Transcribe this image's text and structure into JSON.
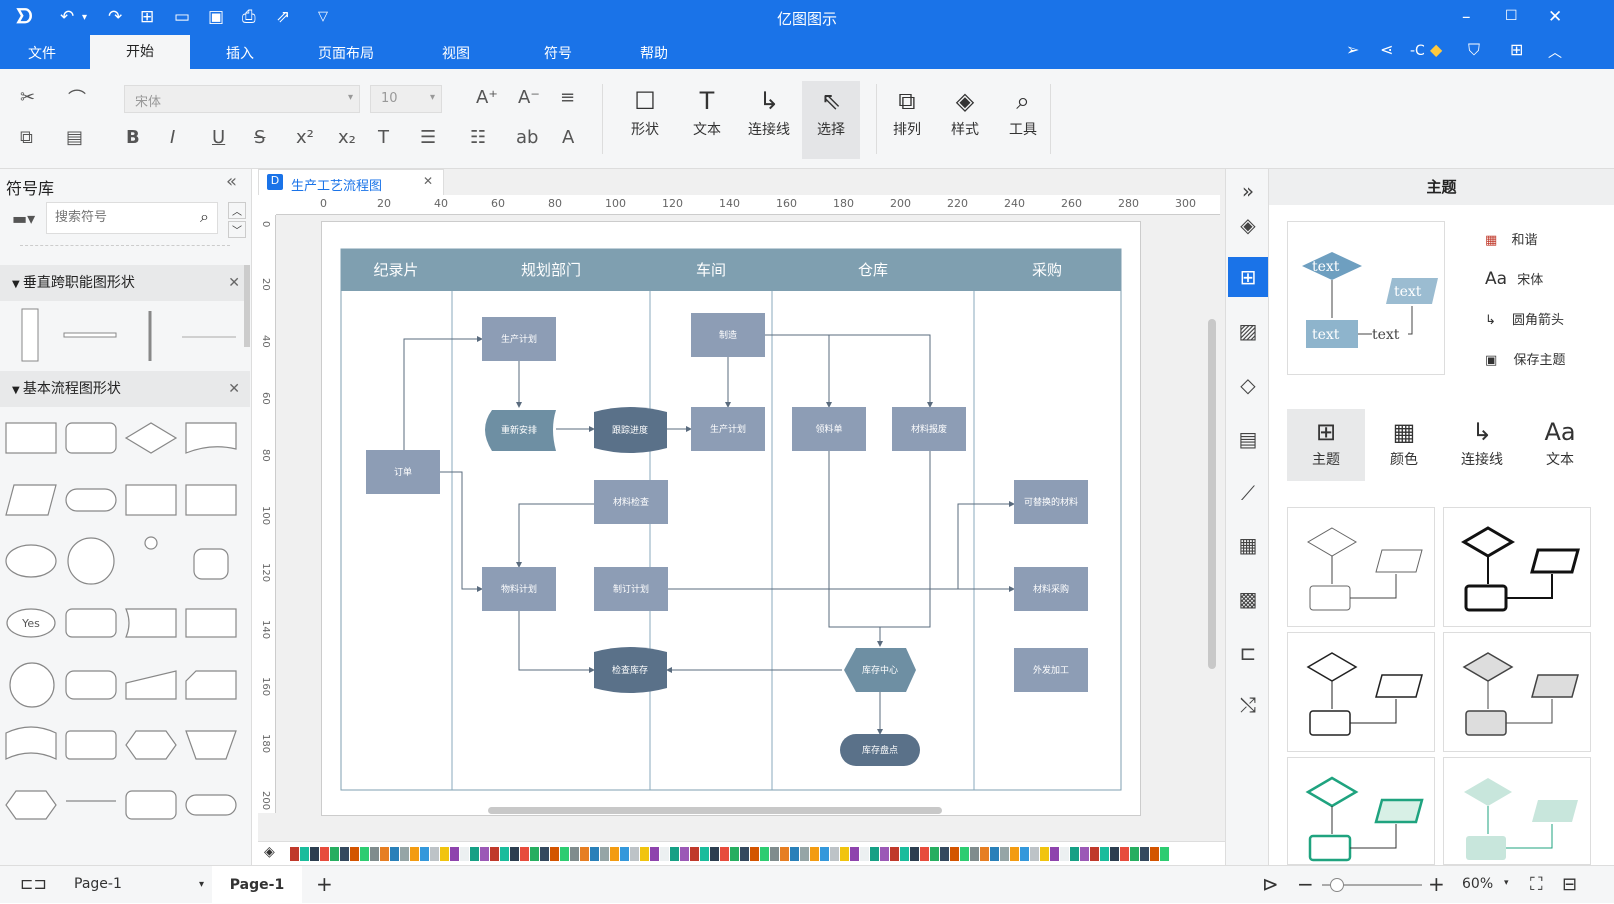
{
  "app": {
    "title": "亿图图示"
  },
  "menu": [
    "文件",
    "开始",
    "插入",
    "页面布局",
    "视图",
    "符号",
    "帮助"
  ],
  "user": {
    "label": "-C"
  },
  "toolbar": {
    "font_family": "宋体",
    "font_size": "10",
    "shape_label": "形状",
    "text_label": "文本",
    "connector_label": "连接线",
    "select_label": "选择",
    "arrange_label": "排列",
    "style_label": "样式",
    "tools_label": "工具"
  },
  "left_panel": {
    "title": "符号库",
    "search_placeholder": "搜索符号",
    "category1": "垂直跨职能图形状",
    "category2": "基本流程图形状",
    "yes_label": "Yes"
  },
  "document": {
    "tab_title": "生产工艺流程图",
    "ruler_h": [
      "0",
      "20",
      "40",
      "60",
      "80",
      "100",
      "120",
      "140",
      "160",
      "180",
      "200",
      "220",
      "240",
      "260",
      "280",
      "300"
    ],
    "ruler_v": [
      "0",
      "20",
      "40",
      "60",
      "80",
      "100",
      "120",
      "140",
      "160",
      "180",
      "200"
    ],
    "lanes": [
      "纪录片",
      "规划部门",
      "车间",
      "仓库",
      "采购"
    ],
    "nodes": {
      "n_order": "订单",
      "n_plan1": "生产计划",
      "n_resched": "重新安排",
      "n_track": "跟踪进度",
      "n_make": "制造",
      "n_plan2": "生产计划",
      "n_pick": "领料单",
      "n_report": "材料报废",
      "n_check": "材料检查",
      "n_mrp": "物料计划",
      "n_setplan": "制订计划",
      "n_alt": "可替换的材料",
      "n_buy": "材料采购",
      "n_stockchk": "检查库存",
      "n_center": "库存中心",
      "n_outsrc": "外发加工",
      "n_count": "库存盘点"
    }
  },
  "right_panel": {
    "title": "主题",
    "sample_text": "text",
    "opt_harmony": "和谐",
    "opt_font": "宋体",
    "opt_arrow": "圆角箭头",
    "opt_save": "保存主题",
    "tabs": [
      "主题",
      "颜色",
      "连接线",
      "文本"
    ]
  },
  "status": {
    "page_select": "Page-1",
    "page_tab": "Page-1",
    "zoom": "60%"
  },
  "colors": {
    "brand": "#1a73e8",
    "lane_header": "#7f9fb0",
    "node": "#8d9db5",
    "node_dark": "#5a7189",
    "node_hex": "#6e8fa3"
  }
}
